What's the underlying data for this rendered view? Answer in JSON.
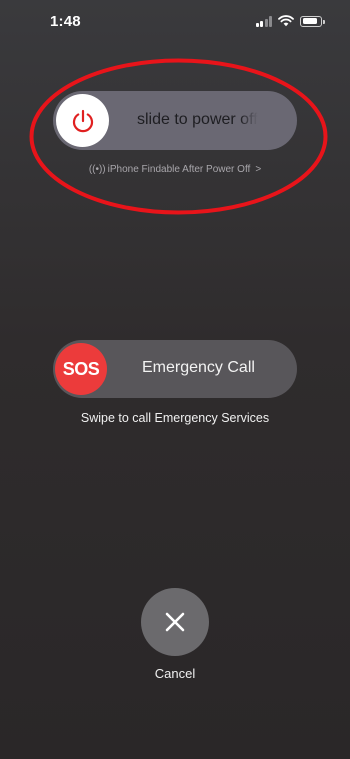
{
  "status_bar": {
    "time": "1:48",
    "icons": [
      "signal-icon",
      "wifi-icon",
      "battery-icon"
    ]
  },
  "power_slider": {
    "label": "slide to power off",
    "icon": "power-icon",
    "knob_color": "#ffffff",
    "icon_color": "#e02020"
  },
  "findable": {
    "icon": "find-my-icon",
    "text": "iPhone Findable After Power Off",
    "chevron": ">"
  },
  "highlight": {
    "color": "#e8141a",
    "shape": "ellipse"
  },
  "sos_slider": {
    "knob_label": "SOS",
    "label": "Emergency Call",
    "hint": "Swipe to call Emergency Services",
    "knob_color": "#ec3b3b"
  },
  "cancel": {
    "label": "Cancel",
    "icon": "close-icon"
  }
}
